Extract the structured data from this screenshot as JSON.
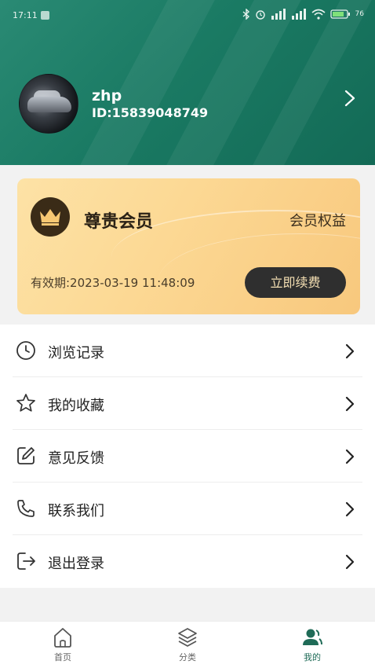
{
  "status_bar": {
    "time": "17:11",
    "battery": "76"
  },
  "profile": {
    "username": "zhp",
    "user_id": "ID:15839048749"
  },
  "vip": {
    "title": "尊贵会员",
    "benefits_link": "会员权益",
    "expiry": "有效期:2023-03-19 11:48:09",
    "renew_button": "立即续费"
  },
  "menu": {
    "items": [
      {
        "label": "浏览记录",
        "icon": "clock-icon"
      },
      {
        "label": "我的收藏",
        "icon": "star-icon"
      },
      {
        "label": "意见反馈",
        "icon": "edit-icon"
      },
      {
        "label": "联系我们",
        "icon": "phone-icon"
      },
      {
        "label": "退出登录",
        "icon": "logout-icon"
      }
    ]
  },
  "tabbar": {
    "tabs": [
      {
        "label": "首页",
        "icon": "home-icon"
      },
      {
        "label": "分类",
        "icon": "layers-icon"
      },
      {
        "label": "我的",
        "icon": "user-icon",
        "active": true
      }
    ]
  },
  "colors": {
    "header": "#1a7a63",
    "vip_card": "#fcd995",
    "renew_button": "#2f2f2f",
    "active_tab": "#1f6b57"
  }
}
